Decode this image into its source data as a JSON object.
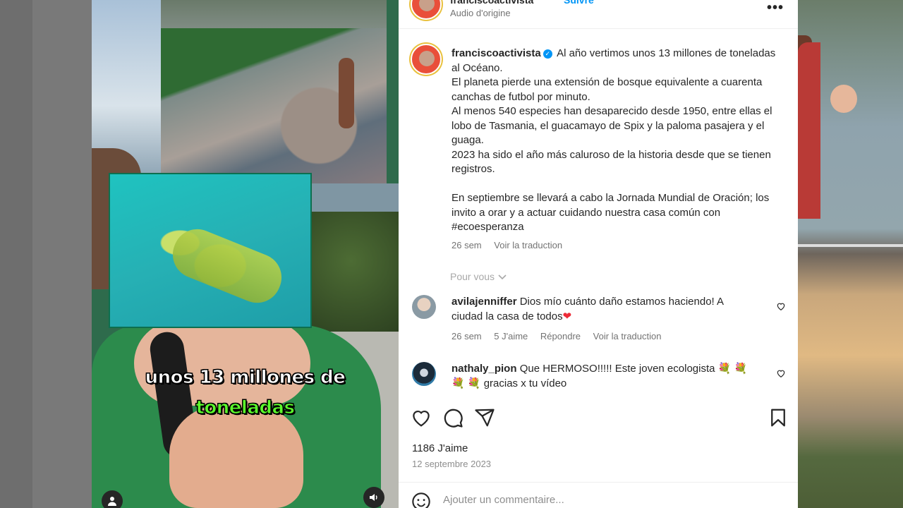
{
  "post": {
    "username": "franciscoactivista",
    "follow_label": "Suivre",
    "audio_label": "Audio d'origine",
    "more_label": "•••"
  },
  "video": {
    "caption_line1": "unos 13 millones de",
    "caption_line2": "toneladas"
  },
  "caption": {
    "username": "franciscoactivista",
    "verified_icon": "verified-badge-icon",
    "lines": [
      "Al año vertimos unos 13 millones de toneladas al Océano.",
      "El planeta pierde una extensión de bosque equivalente a cuarenta canchas de futbol por minuto.",
      "Al menos 540 especies han desaparecido desde 1950, entre ellas el lobo de Tasmania, el guacamayo de Spix y la paloma pasajera y el guaga.",
      "2023 ha sido el año más caluroso de la historia desde que se tienen registros.",
      "",
      "En septiembre se llevará a cabo la Jornada Mundial de Oración; los invito a orar y a actuar cuidando nuestra casa común con",
      "#ecoesperanza"
    ],
    "time": "26 sem",
    "see_translation": "Voir la traduction"
  },
  "for_you_label": "Pour vous",
  "comments": [
    {
      "username": "avilajenniffer",
      "text": "Dios mío cuánto daño estamos haciendo! A ciudad la casa de todos",
      "emoji": "❤",
      "time": "26 sem",
      "likes": "5 J'aime",
      "reply": "Répondre",
      "see_translation": "Voir la traduction"
    },
    {
      "username": "nathaly_pion",
      "text": "Que HERMOSO!!!!! Este joven ecologista",
      "emoji_mid": "💐 💐 💐 💐",
      "text_end": "gracias x tu vídeo"
    }
  ],
  "stats": {
    "likes": "1186 J'aime",
    "date": "12 septembre 2023"
  },
  "comment_box": {
    "placeholder": "Ajouter un commentaire..."
  },
  "colors": {
    "accent_blue": "#0095f6",
    "caption_green": "#5cff2b",
    "heart_red": "#ed2b37"
  }
}
